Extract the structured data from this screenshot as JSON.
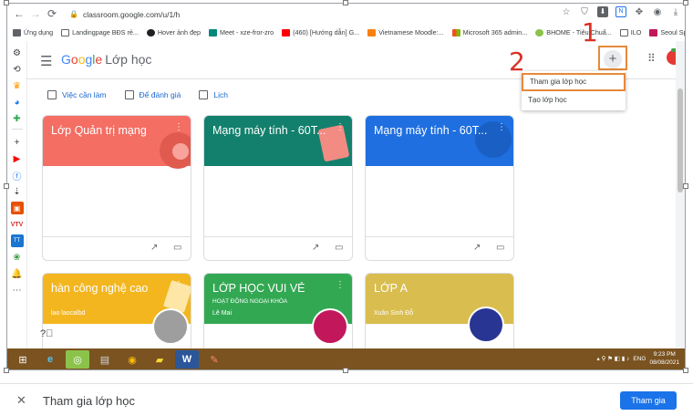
{
  "browser": {
    "url": "classroom.google.com/u/1/h"
  },
  "bookmarks": [
    {
      "label": "Ứng dụng",
      "icon": "apps-icon",
      "color": "#5f6368"
    },
    {
      "label": "Landingpage BĐS rẻ...",
      "icon": "folder-icon",
      "color": "#5f6368"
    },
    {
      "label": "Hover ảnh đẹp",
      "icon": "globe-icon",
      "color": "#202124"
    },
    {
      "label": "Meet - xze-fror-zro",
      "icon": "meet-icon",
      "color": "#00897b"
    },
    {
      "label": "(460) [Hướng dẫn] G...",
      "icon": "youtube-icon",
      "color": "#ff0000"
    },
    {
      "label": "Vietnamese Moodle:...",
      "icon": "moodle-icon",
      "color": "#f98012"
    },
    {
      "label": "Microsoft 365 admin...",
      "icon": "microsoft-icon",
      "color": "#f25022"
    },
    {
      "label": "BHOME - Tiêu Chuẩ...",
      "icon": "leaf-icon",
      "color": "#8bc34a"
    },
    {
      "label": "ILO",
      "icon": "folder-icon",
      "color": "#5f6368"
    },
    {
      "label": "Seoul Spa - Hệ thốn...",
      "icon": "spa-icon",
      "color": "#c2185b"
    }
  ],
  "header": {
    "logo_g1": "G",
    "logo_g2": "o",
    "logo_g3": "o",
    "logo_g4": "g",
    "logo_g5": "l",
    "logo_g6": "e",
    "product": "Lớp học",
    "plus": "+"
  },
  "annotations": {
    "one": "1",
    "two": "2"
  },
  "subnav": {
    "todo": "Việc cần làm",
    "to_review": "Để đánh giá",
    "calendar": "Lịch"
  },
  "dropdown": {
    "join": "Tham gia lớp học",
    "create": "Tạo lớp học"
  },
  "cards": [
    {
      "title": "Lớp Quản trị mạng",
      "subtitle": "",
      "owner": "",
      "color": "#f46e63"
    },
    {
      "title": "Mạng máy tính - 60T...",
      "subtitle": "",
      "owner": "",
      "color": "#12806c"
    },
    {
      "title": "Mạng máy tính - 60T...",
      "subtitle": "",
      "owner": "",
      "color": "#1f6fe0"
    },
    {
      "title": "hàn công nghệ cao",
      "subtitle": "",
      "owner": "lao laocalbd",
      "color": "#f3b61f"
    },
    {
      "title": "LỚP HỌC VUI VẺ",
      "subtitle": "HOẠT ĐỘNG NGOẠI KHÓA",
      "owner": "Lê Mai",
      "color": "#33a853"
    },
    {
      "title": "LỚP A",
      "subtitle": "",
      "owner": "Xuân Sinh Đỗ",
      "color": "#d9bd4f"
    }
  ],
  "taskbar": {
    "lang": "ENG",
    "time": "9:23 PM",
    "date": "08/08/2021"
  },
  "bottom": {
    "title": "Tham gia lớp học",
    "join_button": "Tham gia"
  },
  "colors": {
    "accent": "#1a73e8",
    "highlight": "#e6893b",
    "annotation": "#d93025"
  }
}
